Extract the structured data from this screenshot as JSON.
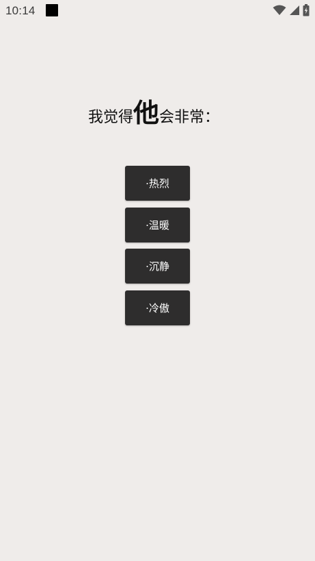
{
  "status_bar": {
    "time": "10:14",
    "icons": [
      "notification-square-icon",
      "wifi-icon",
      "cell-signal-icon",
      "battery-charging-icon"
    ]
  },
  "question": {
    "prefix": "我觉得",
    "emphasis": "他",
    "suffix": "会非常："
  },
  "options": [
    {
      "label": "·热烈"
    },
    {
      "label": "·温暖"
    },
    {
      "label": "·沉静"
    },
    {
      "label": "·冷傲"
    }
  ],
  "colors": {
    "background": "#efecea",
    "button": "#2e2d2d",
    "button_text": "#ffffff",
    "text": "#111111"
  }
}
